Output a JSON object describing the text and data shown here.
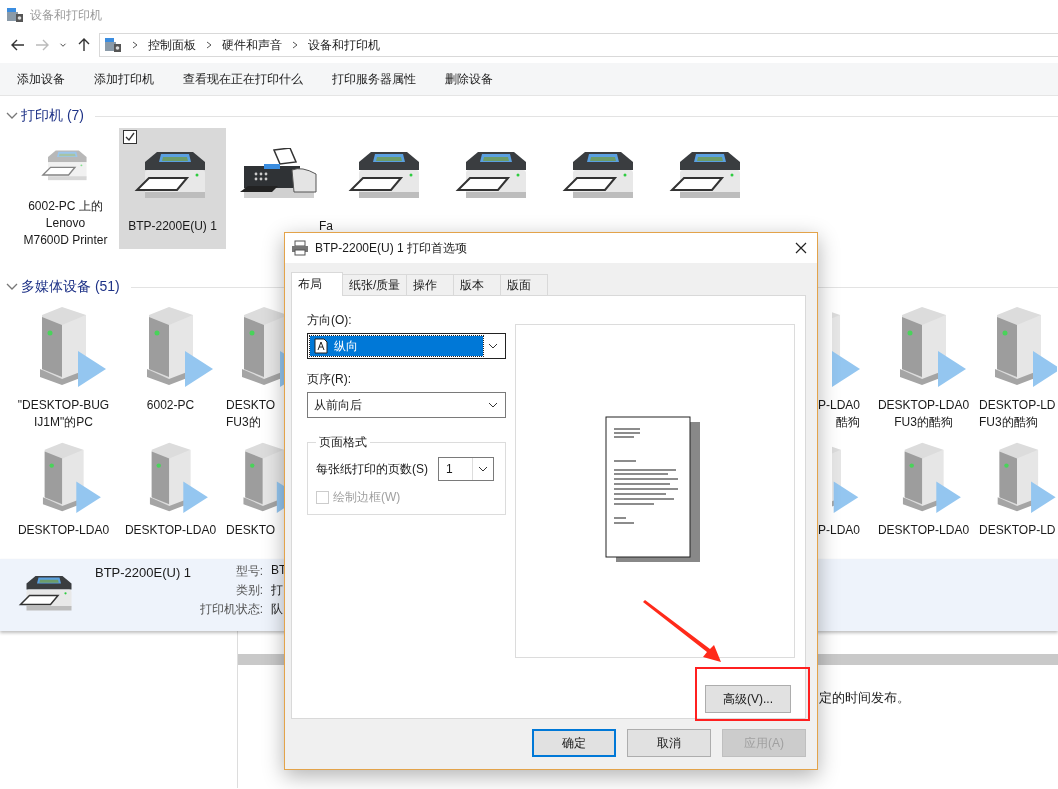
{
  "window": {
    "title": "设备和打印机"
  },
  "nav_buttons": [
    {
      "kind": "back",
      "disabled": false
    },
    {
      "kind": "forward",
      "disabled": true
    },
    {
      "kind": "recent",
      "disabled": false
    },
    {
      "kind": "up",
      "disabled": false
    }
  ],
  "address_bar": {
    "crumbs": [
      "控制面板",
      "硬件和声音",
      "设备和打印机"
    ]
  },
  "toolbar": [
    "添加设备",
    "添加打印机",
    "查看现在正在打印什么",
    "打印服务器属性",
    "删除设备"
  ],
  "printers": {
    "title": "打印机 (7)",
    "expanded": true,
    "items": [
      {
        "kind": "printer",
        "lines": [
          "6002-PC 上的",
          "Lenovo",
          "M7600D Printer"
        ],
        "selected": false,
        "checked": false,
        "dimmed": true
      },
      {
        "kind": "printer",
        "lines": [
          "BTP-2200E(U) 1"
        ],
        "selected": true,
        "checked": true,
        "dimmed": false
      },
      {
        "kind": "fax",
        "lines": [
          "Fa"
        ],
        "selected": false,
        "checked": false,
        "dimmed": false
      },
      {
        "kind": "printer",
        "selected": false,
        "checked": false,
        "dimmed": false
      },
      {
        "kind": "printer",
        "selected": false,
        "checked": false,
        "dimmed": false
      },
      {
        "kind": "printer",
        "selected": false,
        "checked": false,
        "dimmed": false
      },
      {
        "kind": "printer",
        "selected": false,
        "checked": false,
        "dimmed": false
      }
    ]
  },
  "media": {
    "title": "多媒体设备 (51)",
    "expanded": true,
    "rows": [
      {
        "left": [
          {
            "kind": "full",
            "lines": [
              "\"DESKTOP-BUG",
              "IJ1M\"的PC"
            ]
          },
          {
            "kind": "full",
            "lines": [
              "6002-PC"
            ]
          },
          {
            "kind": "cut_end",
            "lines": [
              "DESKTO",
              "FU3的"
            ]
          }
        ],
        "right": [
          {
            "kind": "cut_start",
            "lines": [
              "P-LDA0",
              "酷狗"
            ]
          },
          {
            "kind": "full",
            "lines": [
              "DESKTOP-LDA0",
              "FU3的酷狗"
            ]
          },
          {
            "kind": "cut_end",
            "lines": [
              "DESKTOP-LD",
              "FU3的酷狗"
            ]
          }
        ]
      },
      {
        "left": [
          {
            "kind": "full",
            "lines": [
              "DESKTOP-LDA0"
            ]
          },
          {
            "kind": "full",
            "lines": [
              "DESKTOP-LDA0"
            ]
          },
          {
            "kind": "cut_end",
            "lines": [
              "DESKTO"
            ]
          }
        ],
        "right": [
          {
            "kind": "cut_start",
            "lines": [
              "P-LDA0"
            ]
          },
          {
            "kind": "full",
            "lines": [
              "DESKTOP-LDA0"
            ]
          },
          {
            "kind": "cut_end",
            "lines": [
              "DESKTOP-LD"
            ]
          }
        ]
      }
    ]
  },
  "details": {
    "name": "BTP-2200E(U) 1",
    "fields": [
      {
        "label": "型号:",
        "value": "BT"
      },
      {
        "label": "类别:",
        "value": "打"
      },
      {
        "label": "打印机状态:",
        "value": "队"
      }
    ]
  },
  "background_text": "定的时间发布。",
  "dialog": {
    "title": "BTP-2200E(U) 1 打印首选项",
    "tabs": [
      {
        "label": "布局",
        "selected": true
      },
      {
        "label": "纸张/质量",
        "selected": false
      },
      {
        "label": "操作",
        "selected": false
      },
      {
        "label": "版本",
        "selected": false
      },
      {
        "label": "版面",
        "selected": false
      }
    ],
    "orientation": {
      "label": "方向(O):",
      "value": "纵向",
      "focused": true
    },
    "page_order": {
      "label": "页序(R):",
      "value": "从前向后",
      "focused": false
    },
    "page_format": {
      "title": "页面格式",
      "pages_per_sheet": {
        "label": "每张纸打印的页数(S)",
        "value": "1"
      },
      "draw_borders": {
        "label": "绘制边框(W)",
        "checked": false,
        "disabled": true
      }
    },
    "advanced_button": {
      "label": "高级(V)..."
    },
    "buttons": [
      {
        "label": "确定",
        "default": true,
        "disabled": false
      },
      {
        "label": "取消",
        "default": false,
        "disabled": false
      },
      {
        "label": "应用(A)",
        "default": false,
        "disabled": true
      }
    ]
  }
}
